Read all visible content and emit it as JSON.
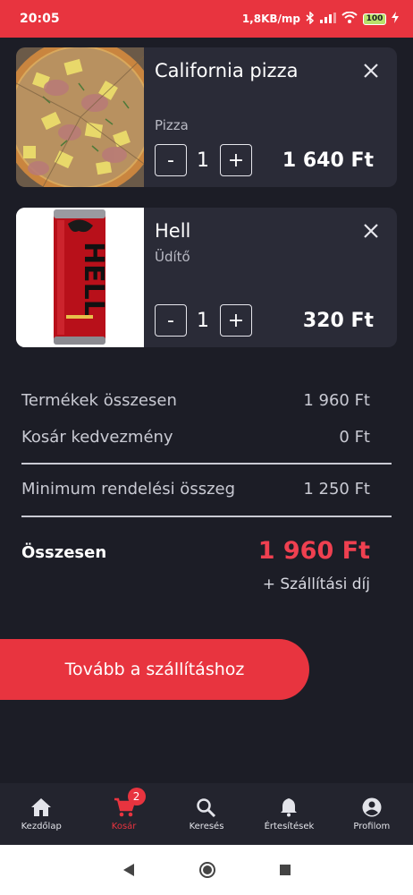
{
  "status_bar": {
    "time": "20:05",
    "network_speed": "1,8KB/mp",
    "battery": "100"
  },
  "cart": {
    "items": [
      {
        "title": "California pizza",
        "category": "Pizza",
        "quantity": "1",
        "price": "1 640  Ft",
        "minus_label": "-",
        "plus_label": "+"
      },
      {
        "title": "Hell",
        "category": "Üdítő",
        "quantity": "1",
        "price": "320  Ft",
        "minus_label": "-",
        "plus_label": "+",
        "can_text": "HELL"
      }
    ]
  },
  "summary": {
    "products_label": "Termékek összesen",
    "products_value": "1 960  Ft",
    "discount_label": "Kosár kedvezmény",
    "discount_value": "0  Ft",
    "minimum_label": "Minimum rendelési összeg",
    "minimum_value": "1 250  Ft",
    "total_label": "Összesen",
    "total_value": "1 960  Ft",
    "shipping_note": "+ Szállítási díj"
  },
  "cta": {
    "label": "Tovább a szállításhoz"
  },
  "bottom_nav": {
    "items": [
      {
        "label": "Kezdőlap",
        "icon": "home-icon"
      },
      {
        "label": "Kosár",
        "icon": "cart-icon",
        "badge": "2",
        "active": true
      },
      {
        "label": "Keresés",
        "icon": "search-icon"
      },
      {
        "label": "Értesítések",
        "icon": "bell-icon"
      },
      {
        "label": "Profilom",
        "icon": "account-icon"
      }
    ]
  },
  "colors": {
    "accent": "#e8343f",
    "background": "#1c1d26",
    "card": "#2a2b37",
    "total_price": "#ef4050"
  }
}
